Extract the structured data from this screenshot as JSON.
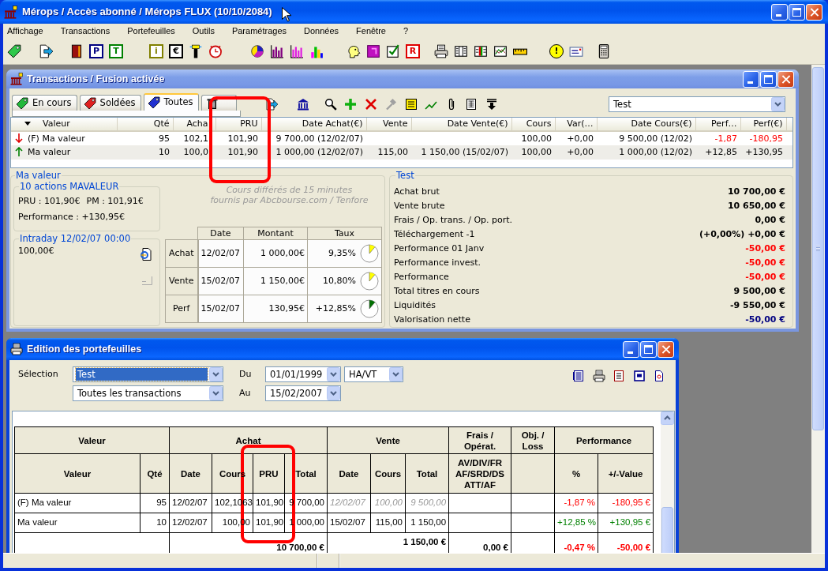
{
  "window": {
    "title": "Mérops / Accès abonné / Mérops FLUX (10/10/2084)"
  },
  "menu": [
    "Affichage",
    "Transactions",
    "Portefeuilles",
    "Outils",
    "Paramétrages",
    "Données",
    "Fenêtre",
    "?"
  ],
  "toolbar": [
    [
      {
        "kind": "tag"
      }
    ],
    [
      {
        "kind": "export"
      }
    ],
    [
      {
        "kind": "book"
      },
      {
        "kind": "letter",
        "glyph": "P",
        "color": "#000080"
      },
      {
        "kind": "letter",
        "glyph": "T",
        "color": "#008000"
      }
    ],
    [
      {
        "kind": "letter",
        "glyph": "i",
        "color": "#808000"
      },
      {
        "kind": "letter",
        "glyph": "€",
        "color": "#000000"
      },
      {
        "kind": "lighthouse"
      },
      {
        "kind": "clock"
      }
    ],
    [
      {
        "kind": "pie"
      },
      {
        "kind": "bars",
        "color": "#800080"
      },
      {
        "kind": "bars",
        "color": "#e020e0"
      },
      {
        "kind": "colorbars"
      }
    ],
    [
      {
        "kind": "head"
      },
      {
        "kind": "square"
      },
      {
        "kind": "check"
      },
      {
        "kind": "letter",
        "glyph": "R",
        "color": "#e00000"
      }
    ],
    [
      {
        "kind": "printer"
      },
      {
        "kind": "columns"
      },
      {
        "kind": "split"
      },
      {
        "kind": "chart"
      },
      {
        "kind": "ruler"
      }
    ],
    [
      {
        "kind": "alert",
        "glyph": "!",
        "color": "#ffff00"
      },
      {
        "kind": "card"
      }
    ],
    [
      {
        "kind": "calculator"
      }
    ]
  ],
  "transactions": {
    "title": "Transactions / Fusion activée",
    "tabs": [
      {
        "kind": "tag",
        "color": "#22b83a",
        "label": "En cours",
        "selected": false
      },
      {
        "kind": "tag",
        "color": "#e02020",
        "label": "Soldées",
        "selected": false
      },
      {
        "kind": "tag",
        "color": "#2030d0",
        "label": "Toutes",
        "selected": true
      },
      {
        "kind": "trash",
        "selected": false
      }
    ],
    "tools": [
      [
        {
          "kind": "export"
        }
      ],
      [
        {
          "kind": "building"
        }
      ],
      [
        {
          "kind": "search"
        },
        {
          "kind": "add"
        },
        {
          "kind": "delete"
        },
        {
          "kind": "hammer"
        },
        {
          "kind": "list"
        },
        {
          "kind": "trend"
        },
        {
          "kind": "clip"
        },
        {
          "kind": "sheet"
        },
        {
          "kind": "sort"
        }
      ]
    ],
    "filter": {
      "value": "Test"
    },
    "columns": [
      {
        "label": "Valeur",
        "sorted": true
      },
      {
        "label": "Qté",
        "sorted": false
      },
      {
        "label": "Acha",
        "sorted": false
      },
      {
        "label": "PRU",
        "sorted": false
      },
      {
        "label": "Date Achat(€)",
        "sorted": false
      },
      {
        "label": "Vente",
        "sorted": false
      },
      {
        "label": "Date Vente(€)",
        "sorted": false
      },
      {
        "label": "Cours",
        "sorted": false
      },
      {
        "label": "Var(…",
        "sorted": false
      },
      {
        "label": "Date Cours(€)",
        "sorted": false
      },
      {
        "label": "Perf…",
        "sorted": false
      },
      {
        "label": "Perf(€)",
        "sorted": false
      }
    ],
    "rows": [
      {
        "negative": true,
        "selected": false,
        "name": "(F) Ma valeur",
        "qty": "95",
        "buy": "102,1",
        "pru": "101,90",
        "buy_date": "9 700,00 (12/02/07)",
        "price": "100,00",
        "var": "+0,00",
        "price_date": "9 500,00 (12/02)",
        "perf_pct": "-1,87",
        "perf": "-180,95"
      },
      {
        "negative": false,
        "selected": true,
        "name": "Ma valeur",
        "qty": "10",
        "buy": "100,0",
        "pru": "101,90",
        "buy_date": "1 000,00 (12/02/07)",
        "sale": "115,00",
        "sale_date": "1 150,00 (15/02/07)",
        "price": "100,00",
        "var": "+0,00",
        "price_date": "1 000,00 (12/02)",
        "perf_pct": "+12,85",
        "perf": "+130,95"
      }
    ],
    "detail": {
      "title": "Ma valeur",
      "holding": {
        "title": "10 actions MAVALEUR",
        "pru": "PRU : 101,90€",
        "pm": "PM : 101,91€",
        "performance": "Performance : +130,95€"
      },
      "intraday": {
        "title": "Intraday 12/02/07 00:00",
        "price": "100,00€"
      },
      "note": "Cours différés de 15 minutes\nfournis par Abcbourse.com / Tenfore",
      "grid": {
        "columns": [
          "Date",
          "Montant",
          "Taux"
        ],
        "rows": [
          {
            "label": "Achat",
            "date": "12/02/07",
            "amount": "1 000,00€",
            "rate": "9,35%",
            "color": "#ffff00"
          },
          {
            "label": "Vente",
            "date": "15/02/07",
            "amount": "1 150,00€",
            "rate": "10,80%",
            "color": "#ffff00"
          },
          {
            "label": "Perf",
            "date": "15/02/07",
            "amount": "130,95€",
            "rate": "+12,85%",
            "color": "#007000"
          }
        ]
      }
    },
    "summary": {
      "title": "Test",
      "rows": [
        {
          "label": "Achat brut",
          "value": "10 700,00 €",
          "color": "#000000"
        },
        {
          "label": "Vente brute",
          "value": "10 650,00 €",
          "color": "#000000"
        },
        {
          "label": "Frais / Op. trans. / Op. port.",
          "value": "0,00 €",
          "color": "#000000"
        },
        {
          "label": "Téléchargement -1",
          "value": "(+0,00%) +0,00 €",
          "color": "#000000"
        },
        {
          "label": "Performance 01 Janv",
          "value": "-50,00 €",
          "color": "#ff0000"
        },
        {
          "label": "Performance invest.",
          "value": "-50,00 €",
          "color": "#ff0000"
        },
        {
          "label": "Performance",
          "value": "-50,00 €",
          "color": "#ff0000"
        },
        {
          "label": "Total titres en cours",
          "value": "9 500,00 €",
          "color": "#000000"
        },
        {
          "label": "Liquidités",
          "value": "-9 550,00 €",
          "color": "#000000"
        },
        {
          "label": "Valorisation nette",
          "value": "-50,00 €",
          "color": "#000080"
        }
      ]
    }
  },
  "edition": {
    "title": "Edition des portefeuilles",
    "selection_label": "Sélection",
    "portfolio": {
      "value": "Test",
      "highlighted": true
    },
    "scope": {
      "value": "Toutes les transactions",
      "highlighted": false
    },
    "from_label": "Du",
    "from": {
      "value": "01/01/1999"
    },
    "mode": {
      "value": "HA/VT"
    },
    "to_label": "Au",
    "to": {
      "value": "15/02/2007"
    },
    "actions": [
      {
        "kind": "report"
      },
      {
        "kind": "printer"
      },
      {
        "kind": "lines"
      },
      {
        "kind": "frame"
      },
      {
        "kind": "page"
      }
    ],
    "report": {
      "groups": [
        {
          "label": "Valeur",
          "columns": [
            "Valeur",
            "Qté"
          ]
        },
        {
          "label": "Achat",
          "columns": [
            "Date",
            "Cours",
            "PRU",
            "Total"
          ]
        },
        {
          "label": "Vente",
          "columns": [
            "Date",
            "Cours",
            "Total"
          ]
        },
        {
          "label": "Frais /\nOpérat.",
          "columns": [
            "AV/DIV/FR\nAF/SRD/DS\nATT/AF"
          ]
        },
        {
          "label": "Obj. /\nLoss"
        },
        {
          "label": "Performance",
          "columns": [
            "%",
            "+/-Value"
          ]
        }
      ],
      "rows": [
        {
          "provisional": true,
          "negative": true,
          "name": "(F) Ma valeur",
          "qty": "95",
          "buy_date": "12/02/07",
          "buy_price": "102,1063",
          "pru": "101,90",
          "buy_total": "9 700,00",
          "sale_date": "12/02/07",
          "sale_price": "100,00",
          "sale_total": "9 500,00",
          "perf_pct": "-1,87 %",
          "perf_value": "-180,95 €"
        },
        {
          "provisional": false,
          "negative": false,
          "name": "Ma valeur",
          "qty": "10",
          "buy_date": "12/02/07",
          "buy_price": "100,00",
          "pru": "101,90",
          "buy_total": "1 000,00",
          "sale_date": "15/02/07",
          "sale_price": "115,00",
          "sale_total": "1 150,00",
          "perf_pct": "+12,85 %",
          "perf_value": "+130,95 €"
        }
      ],
      "totals": {
        "negative": true,
        "buy_total": "10 700,00 €",
        "sale_total": "1 150,00 €",
        "fees": "0,00 €",
        "perf_pct": "-0,47 %",
        "perf_value": "-50,00 €"
      }
    }
  }
}
